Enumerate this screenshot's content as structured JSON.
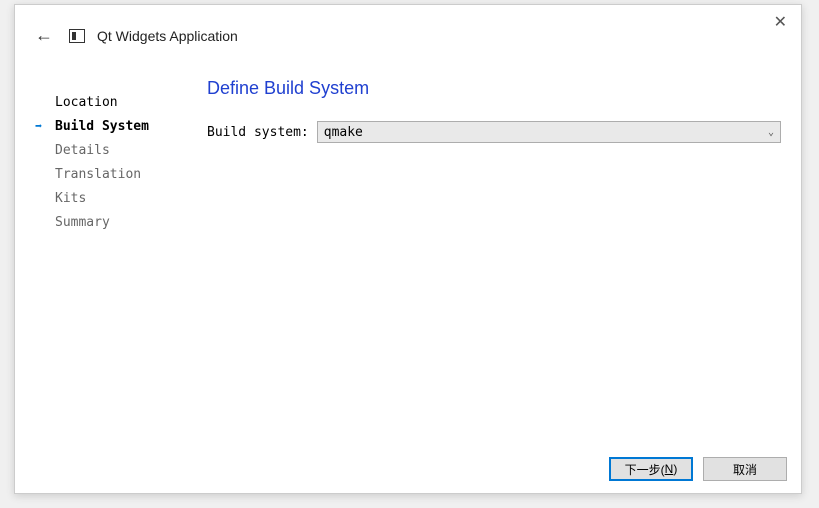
{
  "header": {
    "app_title": "Qt Widgets Application"
  },
  "sidebar": {
    "steps": [
      {
        "label": "Location",
        "state": "done"
      },
      {
        "label": "Build System",
        "state": "active"
      },
      {
        "label": "Details",
        "state": "pending"
      },
      {
        "label": "Translation",
        "state": "pending"
      },
      {
        "label": "Kits",
        "state": "pending"
      },
      {
        "label": "Summary",
        "state": "pending"
      }
    ]
  },
  "main": {
    "title": "Define Build System",
    "build_system_label": "Build system:",
    "build_system_value": "qmake"
  },
  "footer": {
    "next_label": "下一步(",
    "next_mnemonic": "N",
    "next_label_end": ")",
    "cancel_label": "取消"
  }
}
